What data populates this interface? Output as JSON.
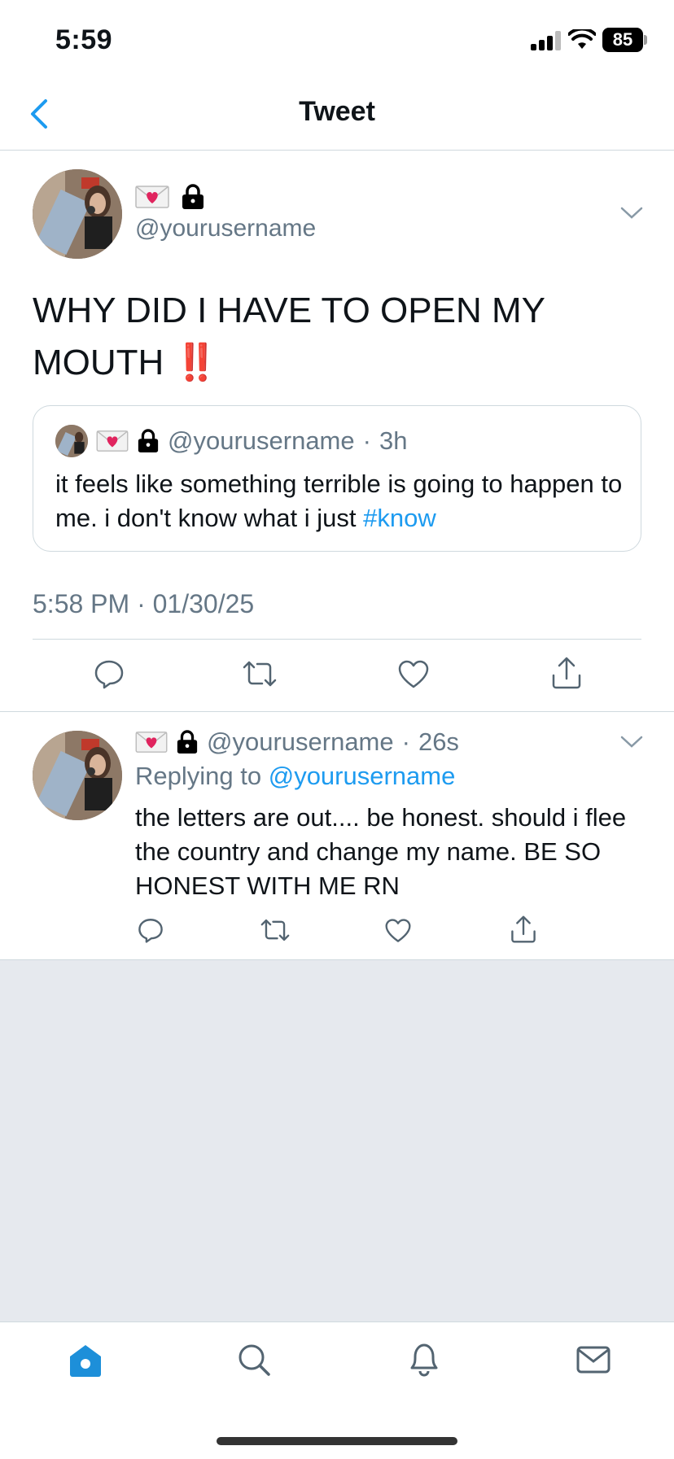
{
  "status_bar": {
    "time": "5:59",
    "battery": "85"
  },
  "header": {
    "title": "Tweet"
  },
  "main_tweet": {
    "handle": "@yourusername",
    "text": "WHY DID I HAVE TO OPEN MY MOUTH",
    "emphasis": "‼️",
    "timestamp": "5:58 PM · 01/30/25"
  },
  "quoted_tweet": {
    "handle": "@yourusername",
    "separator": "·",
    "age": "3h",
    "text": "it feels like something terrible is going to happen to me. i don't know what i just",
    "hashtag": "#know"
  },
  "reply": {
    "handle": "@yourusername",
    "separator": "·",
    "age": "26s",
    "replying_prefix": "Replying to",
    "replying_handle": "@yourusername",
    "text": "the letters are out.... be honest. should i flee the country and change my name. BE SO HONEST WITH ME RN"
  },
  "colors": {
    "accent": "#1d9bf0",
    "muted": "#657786",
    "divider": "#cfd9de",
    "background_gray": "#e6e9ee"
  },
  "icons": [
    "back-chevron-icon",
    "chevron-down-icon",
    "reply-icon",
    "retweet-icon",
    "like-icon",
    "share-icon",
    "home-icon",
    "search-icon",
    "notifications-icon",
    "messages-icon",
    "love-letter-icon",
    "lock-icon"
  ]
}
